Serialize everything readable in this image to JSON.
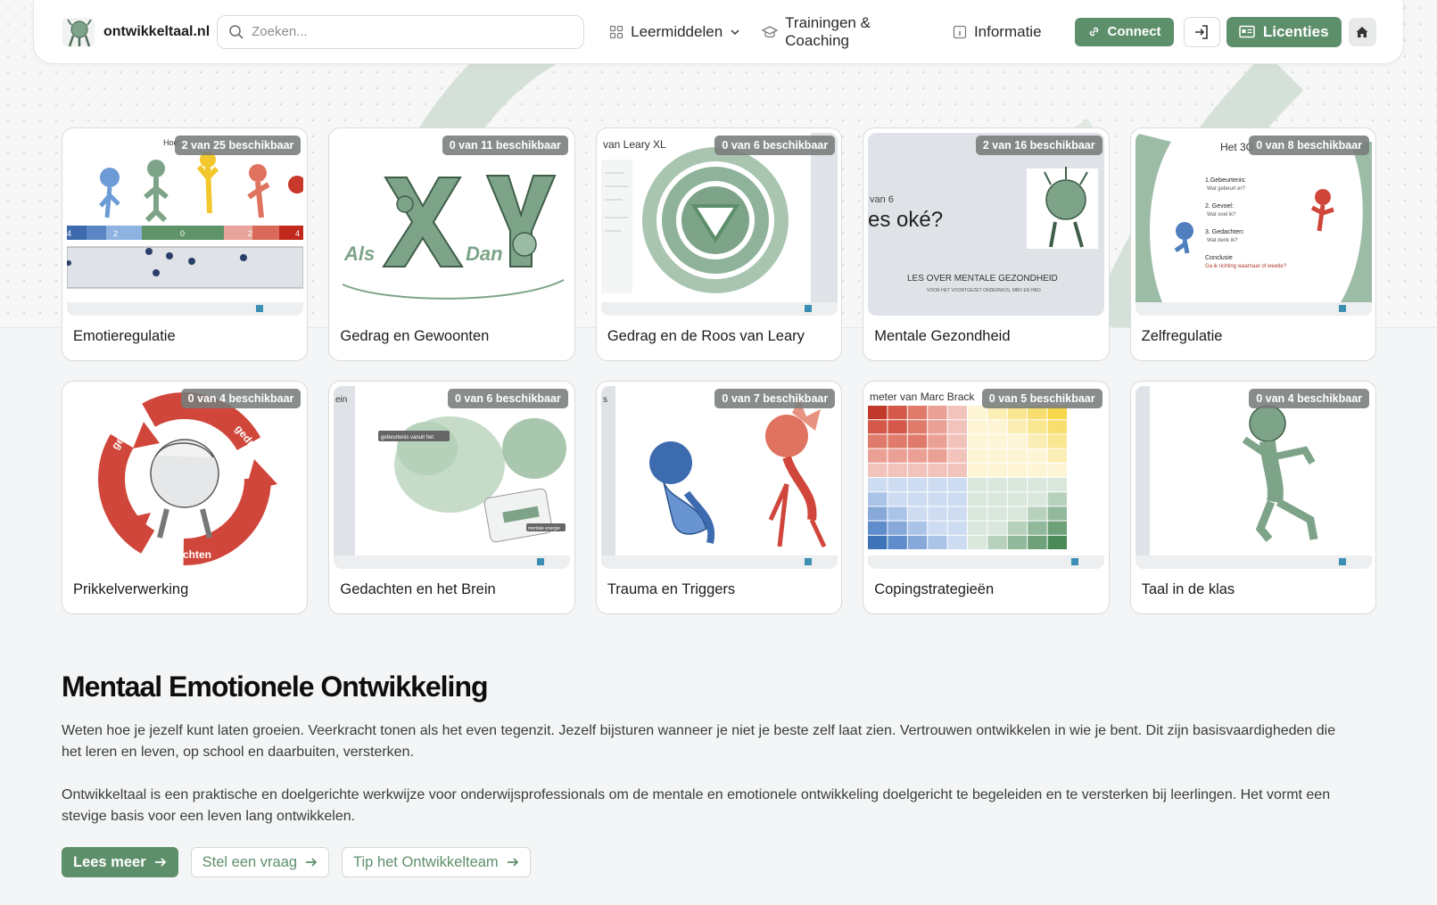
{
  "header": {
    "logo_text": "ontwikkeltaal.nl",
    "search_placeholder": "Zoeken...",
    "nav": [
      {
        "label": "Leermiddelen",
        "icon": "grid-icon"
      },
      {
        "label": "Trainingen & Coaching",
        "icon": "graduation-cap-icon"
      },
      {
        "label": "Informatie",
        "icon": "info-icon"
      }
    ],
    "connect_label": "Connect",
    "licenties_label": "Licenties"
  },
  "cards": [
    {
      "title": "Emotieregulatie",
      "badge": "2 van 25 beschikbaar"
    },
    {
      "title": "Gedrag en Gewoonten",
      "badge": "0 van 11 beschikbaar"
    },
    {
      "title": "Gedrag en de Roos van Leary",
      "badge": "0 van 6 beschikbaar"
    },
    {
      "title": "Mentale Gezondheid",
      "badge": "2 van 16 beschikbaar"
    },
    {
      "title": "Zelfregulatie",
      "badge": "0 van 8 beschikbaar"
    },
    {
      "title": "Prikkelverwerking",
      "badge": "0 van 4 beschikbaar"
    },
    {
      "title": "Gedachten en het Brein",
      "badge": "0 van 6 beschikbaar"
    },
    {
      "title": "Trauma en Triggers",
      "badge": "0 van 7 beschikbaar"
    },
    {
      "title": "Copingstrategieën",
      "badge": "0 van 5 beschikbaar"
    },
    {
      "title": "Taal in de klas",
      "badge": "0 van 4 beschikbaar"
    }
  ],
  "thumb_text": {
    "emotie_head": "Hoe",
    "emotie_scale": [
      "4",
      "2",
      "0",
      "2",
      "4"
    ],
    "xy_left": "Als",
    "xy_right": "Dan",
    "leary_head": "van Leary XL",
    "mentaal_small": "van 6",
    "mentaal_big": "es oké?",
    "mentaal_les": "LES OVER MENTALE GEZONDHEID",
    "mentaal_sub": "VOOR HET VOORTGEZET ONDERWIJS, MBO EN HBO",
    "zelf_head": "Het 3G",
    "zelf_items": [
      "1.Gebeurtenis:",
      "Wat gebeurt er?",
      "2. Gevoel:",
      "Wat voel ik?",
      "3. Gedachten:",
      "Wat denk ik?",
      "Conclusie",
      "Ga ik richting waarnaar of weede?"
    ],
    "prikkel_words": [
      "gevoel",
      "gedrag",
      "gedachten"
    ],
    "brein_head": "ein",
    "brein_labels": [
      "gebeurtenis vanuit het",
      "mentale energie"
    ],
    "trauma_head": "s",
    "coping_head": "meter van Marc Brack"
  },
  "section": {
    "title": "Mentaal Emotionele Ontwikkeling",
    "p1": "Weten hoe je jezelf kunt laten groeien. Veerkracht tonen als het even tegenzit. Jezelf bijsturen wanneer je niet je beste zelf laat zien. Vertrouwen ontwikkelen in wie je bent. Dit zijn basisvaardigheden die het leren en leven, op school en daarbuiten, versterken.",
    "p2": "Ontwikkeltaal is een praktische en doelgerichte werkwijze voor onderwijsprofessionals om de mentale en emotionele ontwikkeling doelgericht te begeleiden en te versterken bij leerlingen. Het vormt een stevige basis voor een leven lang ontwikkelen.",
    "buttons": [
      "Lees meer",
      "Stel een vraag",
      "Tip het Ontwikkelteam"
    ]
  },
  "colors": {
    "brand_green": "#5e8f6b",
    "figure_green": "#7da488",
    "red": "#d0463a",
    "blue": "#4f7fbf"
  }
}
